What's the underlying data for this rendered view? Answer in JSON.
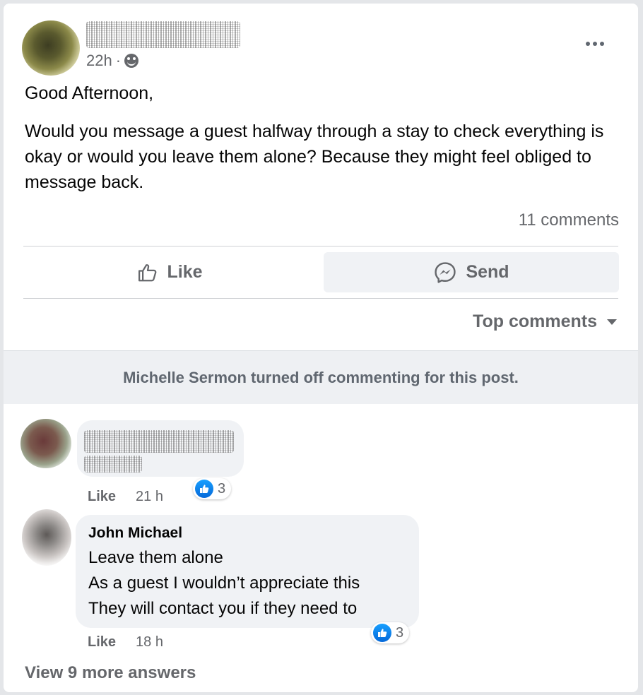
{
  "post": {
    "time": "22h",
    "separator": "·",
    "greeting": "Good Afternoon,",
    "body": "Would you message a guest halfway through a stay to check everything is okay or would you leave them alone?  Because they might feel obliged to message back.",
    "comments_count": "11 comments"
  },
  "actions": {
    "like_label": "Like",
    "send_label": "Send"
  },
  "sort": {
    "label": "Top comments"
  },
  "notice": "Michelle Sermon turned off commenting for this post.",
  "comments": [
    {
      "like_label": "Like",
      "time": "21 h",
      "reaction_count": "3"
    },
    {
      "author": "John Michael",
      "lines": [
        "Leave them alone",
        "As a guest I wouldn’t appreciate this",
        "They will contact you if they need to"
      ],
      "like_label": "Like",
      "time": "18 h",
      "reaction_count": "3"
    }
  ],
  "view_more": "View 9 more answers",
  "icons": {
    "audience": "public-globe-icon",
    "menu": "more-options-icon",
    "like": "thumbs-up-outline-icon",
    "send": "messenger-icon",
    "sort": "caret-down-icon",
    "reaction": "like-reaction-icon"
  },
  "colors": {
    "accent": "#1877f2",
    "secondary_text": "#65676b",
    "bubble": "#f0f2f5"
  }
}
